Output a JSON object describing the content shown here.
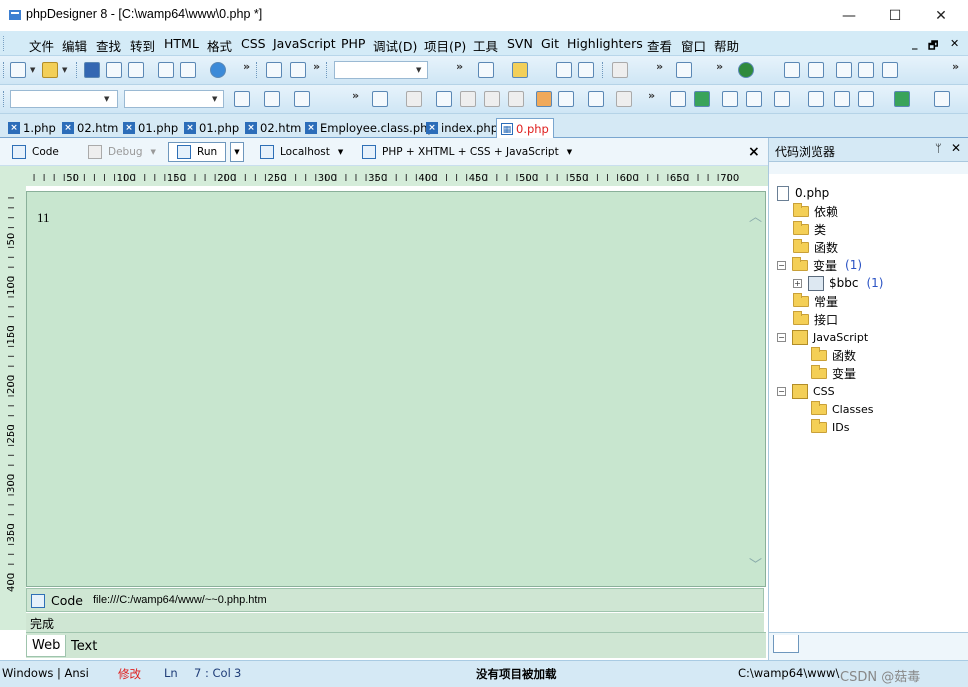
{
  "window": {
    "title": "phpDesigner 8 - [C:\\wamp64\\www\\0.php *]",
    "minimize_glyph": "—",
    "maximize_glyph": "☐",
    "close_glyph": "✕"
  },
  "menubar": {
    "items": [
      "文件",
      "编辑",
      "查找",
      "转到",
      "HTML",
      "格式",
      "CSS",
      "JavaScript",
      "PHP",
      "调试(D)",
      "项目(P)",
      "工具",
      "SVN",
      "Git",
      "Highlighters",
      "查看",
      "窗口",
      "帮助"
    ],
    "mdi_controls": [
      "_",
      "🗗",
      "✕"
    ]
  },
  "doc_tabs": [
    {
      "label": "1.php",
      "active": false
    },
    {
      "label": "02.htm",
      "active": false
    },
    {
      "label": "01.php",
      "active": false
    },
    {
      "label": "01.php",
      "active": false
    },
    {
      "label": "02.htm",
      "active": false
    },
    {
      "label": "Employee.class.php",
      "active": false
    },
    {
      "label": "index.php",
      "active": false
    },
    {
      "label": "0.php",
      "active": true
    }
  ],
  "editor_toolbar": {
    "code": "Code",
    "debug": "Debug",
    "run": "Run",
    "localhost": "Localhost",
    "highlighter": "PHP + XHTML + CSS + JavaScript",
    "close": "×"
  },
  "ruler": {
    "h_ticks": [
      "50",
      "100",
      "150",
      "200",
      "250",
      "300",
      "350",
      "400",
      "450",
      "500",
      "550",
      "600",
      "650",
      "700"
    ],
    "v_ticks": [
      "50",
      "100",
      "150",
      "200",
      "250",
      "300",
      "350",
      "400"
    ]
  },
  "editor": {
    "content": "11",
    "scroll_up": "︿",
    "scroll_down": "﹀"
  },
  "browser": {
    "code_tab": "Code",
    "path": "file:///C:/wamp64/www/~~0.php.htm",
    "done": "完成",
    "tabs": [
      "Web",
      "Text"
    ]
  },
  "side_panel": {
    "title": "代码浏览器",
    "pin": "ᛘ",
    "close": "✕",
    "tree": {
      "root": "0.php",
      "php_nodes": [
        "依赖",
        "类",
        "函数"
      ],
      "variables": {
        "label": "变量",
        "count": "(1)"
      },
      "variable_child": {
        "label": "$bbc",
        "count": "(1)"
      },
      "php_nodes_after": [
        "常量",
        "接口"
      ],
      "javascript": {
        "label": "JavaScript",
        "children": [
          "函数",
          "变量"
        ]
      },
      "css": {
        "label": "CSS",
        "children": [
          "Classes",
          "IDs"
        ]
      }
    }
  },
  "statusbar": {
    "encoding": "Windows | Ansi",
    "modified": "修改",
    "ln_label": "Ln",
    "position": "7 : Col",
    "col": "3",
    "project": "没有项目被加载",
    "dir": "C:\\wamp64\\www\\",
    "watermark": "CSDN @菇毒"
  },
  "colors": {
    "editor_bg": "#c8e6cf",
    "chrome_bg": "#d5e9f5",
    "modified": "#e0201f",
    "active_tab_text": "#e0201f",
    "count": "#2b53c4"
  }
}
